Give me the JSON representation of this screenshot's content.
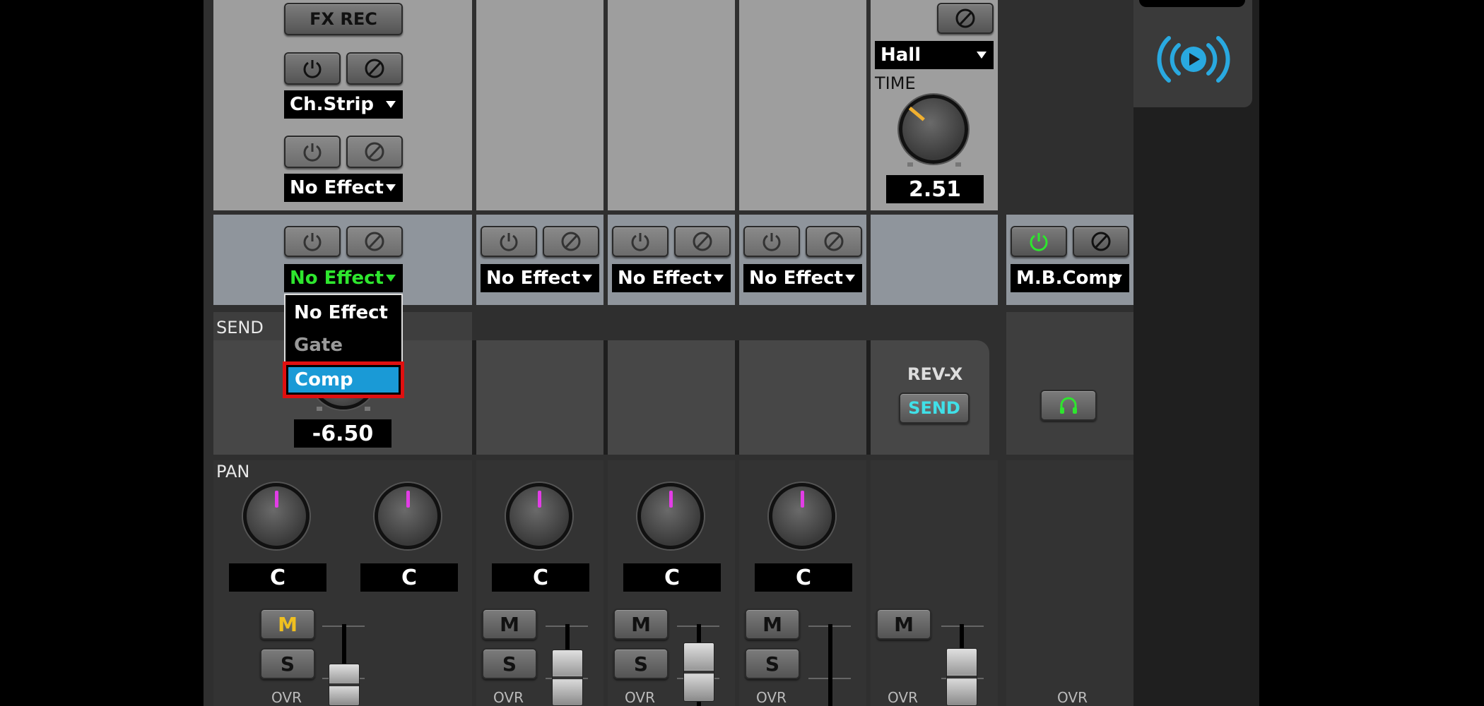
{
  "master": {
    "fx_rec_label": "FX REC",
    "insert1_value": "Ch.Strip",
    "insert2_value": "No Effect",
    "ch1_effect_value": "No Effect",
    "send_label": "SEND",
    "send_value": "-6.50",
    "pan_label": "PAN"
  },
  "reverb": {
    "type_value": "Hall",
    "time_label": "TIME",
    "time_value": "2.51",
    "rev_label": "REV-X",
    "send_button_label": "SEND"
  },
  "effect_dropdown_menu": {
    "items": [
      "No Effect",
      "Gate",
      "Comp"
    ],
    "highlighted": "Comp",
    "disabled": "Gate"
  },
  "channels": [
    {
      "effect": "No Effect",
      "pan": "C",
      "mute": "M",
      "solo": "S",
      "ovr": "OVR"
    },
    {
      "effect": "No Effect",
      "pan": "C",
      "mute": "M",
      "solo": "S",
      "ovr": "OVR"
    },
    {
      "effect": "No Effect",
      "pan": "C",
      "mute": "M",
      "solo": "S",
      "ovr": "OVR"
    }
  ],
  "ch1": {
    "pan_left": "C",
    "pan_right": "C",
    "mute": "M",
    "solo": "S",
    "ovr": "OVR"
  },
  "rev_channel": {
    "mute": "M",
    "ovr": "OVR"
  },
  "output": {
    "effect": "M.B.Comp",
    "ovr": "OVR"
  },
  "colors": {
    "active_green": "#2ee62e",
    "mute_yellow": "#f0c020",
    "highlight_blue": "#1a9ad6",
    "callout_red": "#e01010",
    "send_cyan": "#40e0e8",
    "stream_icon_blue": "#29a9e0",
    "pan_magenta": "#e23de6",
    "knob_orange": "#f0b030"
  },
  "icons": {
    "power": "power-icon",
    "edit": "edit-icon",
    "headphones": "headphones-icon",
    "stream": "broadcast-play-icon"
  }
}
